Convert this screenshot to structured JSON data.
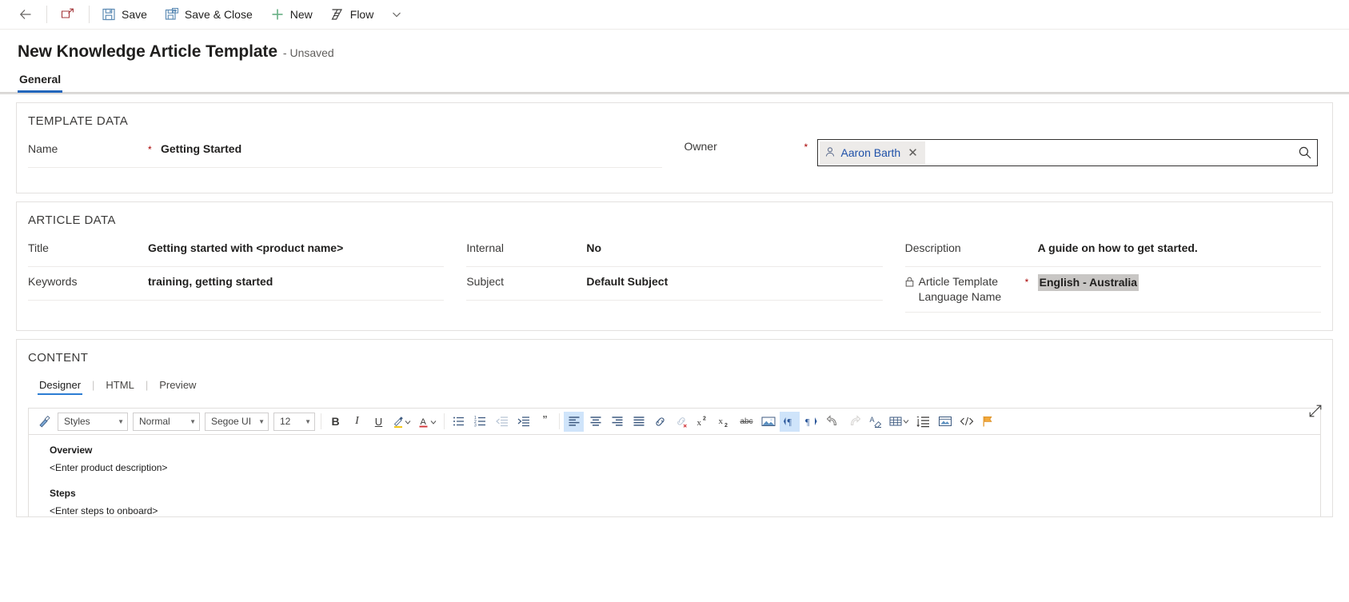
{
  "commandbar": {
    "back_label": "",
    "popout_label": "",
    "items": [
      {
        "icon": "save-icon",
        "label": "Save"
      },
      {
        "icon": "save-and-close-icon",
        "label": "Save & Close"
      },
      {
        "icon": "new-plus-icon",
        "label": "New"
      },
      {
        "icon": "flow-icon",
        "label": "Flow"
      }
    ],
    "overflow_caret": "⌄"
  },
  "header": {
    "title": "New Knowledge Article Template",
    "subtitle": "- Unsaved"
  },
  "tabs": [
    {
      "label": "General",
      "active": true
    }
  ],
  "template_data": {
    "section_title": "TEMPLATE DATA",
    "name": {
      "label": "Name",
      "required": "*",
      "value": "Getting Started"
    },
    "owner": {
      "label": "Owner",
      "required": "*",
      "chip_name": "Aaron Barth",
      "chip_icon": "person-icon",
      "remove_icon": "close-icon",
      "search_icon": "search-icon",
      "focused": true
    }
  },
  "article_data": {
    "section_title": "ARTICLE DATA",
    "left": [
      {
        "label": "Title",
        "value": "Getting started with <product name>",
        "required": ""
      },
      {
        "label": "Keywords",
        "value": "training, getting started",
        "required": ""
      }
    ],
    "middle": [
      {
        "label": "Internal",
        "value": "No",
        "required": ""
      },
      {
        "label": "Subject",
        "value": "Default Subject",
        "required": ""
      }
    ],
    "right": [
      {
        "label": "Description",
        "value": "A guide on how to get started.",
        "required": "",
        "locked": false,
        "selected": false
      },
      {
        "label": "Article Template Language Name",
        "value": "English - Australia",
        "required": "*",
        "locked": true,
        "lock_icon": "lock-icon",
        "selected": true
      }
    ]
  },
  "content": {
    "section_title": "CONTENT",
    "editor_tabs": [
      {
        "label": "Designer",
        "active": true
      },
      {
        "label": "HTML",
        "active": false
      },
      {
        "label": "Preview",
        "active": false
      }
    ],
    "tab_separator": "|",
    "expand_icon": "expand-diagonal-icon",
    "toolbar": {
      "format_painter_icon": "format-painter-icon",
      "selects": [
        {
          "name": "styles-select",
          "value": "Styles"
        },
        {
          "name": "paragraph-format-select",
          "value": "Normal"
        },
        {
          "name": "font-family-select",
          "value": "Segoe UI"
        },
        {
          "name": "font-size-select",
          "value": "12"
        }
      ],
      "buttons": [
        {
          "icon": "bold-icon",
          "glyph": "B",
          "active": false
        },
        {
          "icon": "italic-icon",
          "glyph": "I",
          "active": false
        },
        {
          "icon": "underline-icon",
          "glyph": "U",
          "active": false
        },
        {
          "icon": "text-highlight-color-icon",
          "glyph": "",
          "active": false
        },
        {
          "icon": "font-color-icon",
          "glyph": "A",
          "active": false
        },
        {
          "icon": "bulleted-list-icon",
          "glyph": "",
          "active": false
        },
        {
          "icon": "numbered-list-icon",
          "glyph": "",
          "active": false
        },
        {
          "icon": "decrease-indent-icon",
          "glyph": "",
          "active": false
        },
        {
          "icon": "increase-indent-icon",
          "glyph": "",
          "active": false
        },
        {
          "icon": "block-quote-icon",
          "glyph": "”",
          "active": false
        },
        {
          "icon": "align-left-icon",
          "glyph": "",
          "active": true
        },
        {
          "icon": "align-center-icon",
          "glyph": "",
          "active": false
        },
        {
          "icon": "align-right-icon",
          "glyph": "",
          "active": false
        },
        {
          "icon": "insert-link-icon",
          "glyph": "",
          "active": false
        },
        {
          "icon": "remove-link-icon",
          "glyph": "",
          "active": false
        },
        {
          "icon": "superscript-icon",
          "glyph": "",
          "active": false
        },
        {
          "icon": "subscript-icon",
          "glyph": "",
          "active": false
        },
        {
          "icon": "strikethrough-icon",
          "glyph": "abc",
          "active": false
        },
        {
          "icon": "insert-image-icon",
          "glyph": "",
          "active": false
        },
        {
          "icon": "ltr-direction-icon",
          "glyph": "",
          "active": true
        },
        {
          "icon": "rtl-direction-icon",
          "glyph": "",
          "active": false
        },
        {
          "icon": "undo-icon",
          "glyph": "",
          "active": false
        },
        {
          "icon": "redo-icon",
          "glyph": "",
          "active": false
        },
        {
          "icon": "clear-formatting-icon",
          "glyph": "",
          "active": false
        },
        {
          "icon": "table-icon",
          "glyph": "",
          "active": false
        },
        {
          "icon": "line-spacing-icon",
          "glyph": "",
          "active": false
        },
        {
          "icon": "insert-page-break-icon",
          "glyph": "",
          "active": false
        },
        {
          "icon": "source-code-icon",
          "glyph": "",
          "active": false
        },
        {
          "icon": "flag-icon",
          "glyph": "",
          "active": false
        }
      ]
    },
    "document": [
      {
        "type": "heading",
        "text": "Overview"
      },
      {
        "type": "paragraph",
        "text": "<Enter product description>"
      },
      {
        "type": "heading",
        "text": "Steps"
      },
      {
        "type": "paragraph",
        "text": "<Enter steps to onboard>"
      }
    ]
  },
  "colors": {
    "accent": "#2266bb",
    "required_asterisk": "#a80000",
    "chip_text": "#1f51a9",
    "selection_highlight": "#c8c6c4",
    "toolbar_active": "#cfe4fa",
    "save_icon": "#5e8cb5",
    "new_icon": "#6eb48a"
  }
}
